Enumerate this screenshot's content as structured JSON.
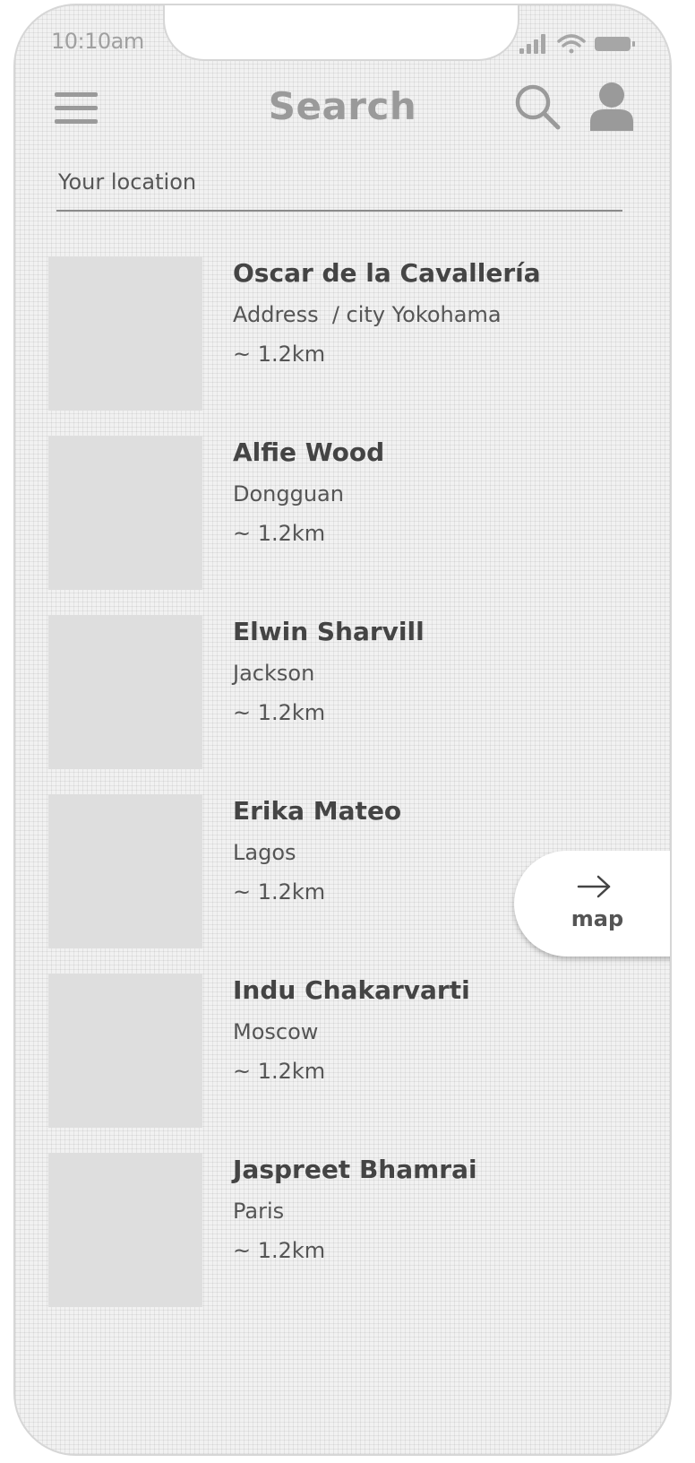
{
  "status_bar": {
    "time": "10:10am"
  },
  "header": {
    "title": "Search",
    "menu_icon": "hamburger-menu-icon",
    "search_icon": "magnifier-icon",
    "profile_icon": "user-avatar-icon"
  },
  "location": {
    "placeholder": "Your location"
  },
  "results": [
    {
      "name": "Oscar de la Cavallería",
      "address": "Address  / city Yokohama",
      "distance": "~ 1.2km"
    },
    {
      "name": "Alfie Wood",
      "address": "Dongguan",
      "distance": "~ 1.2km"
    },
    {
      "name": "Elwin Sharvill",
      "address": "Jackson",
      "distance": "~ 1.2km"
    },
    {
      "name": "Erika Mateo",
      "address": "Lagos",
      "distance": "~ 1.2km"
    },
    {
      "name": "Indu Chakarvarti",
      "address": "Moscow",
      "distance": "~ 1.2km"
    },
    {
      "name": "Jaspreet Bhamrai",
      "address": "Paris",
      "distance": "~ 1.2km"
    }
  ],
  "map_button": {
    "label": "map",
    "icon": "arrow-right-icon"
  },
  "colors": {
    "frame": "#d6d6d6",
    "background": "#f1f1f1",
    "thumbnail": "#dedede",
    "text_dark": "#444444",
    "text_muted": "#9a9a9a"
  }
}
